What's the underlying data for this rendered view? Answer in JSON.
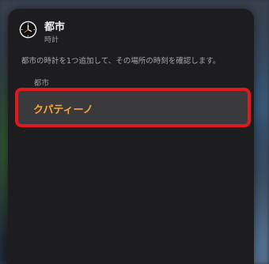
{
  "widget": {
    "title": "都市",
    "subtitle": "時計",
    "icon": "clock-icon",
    "description": "都市の時計を1つ追加して、その場所の時刻を確認します。",
    "section_label": "都市",
    "selected_city": "クパティーノ"
  },
  "colors": {
    "panel_bg": "#1d1d1f",
    "row_bg": "#3a3a3c",
    "city_text": "#f5a53b",
    "highlight_border": "#e0191f"
  }
}
